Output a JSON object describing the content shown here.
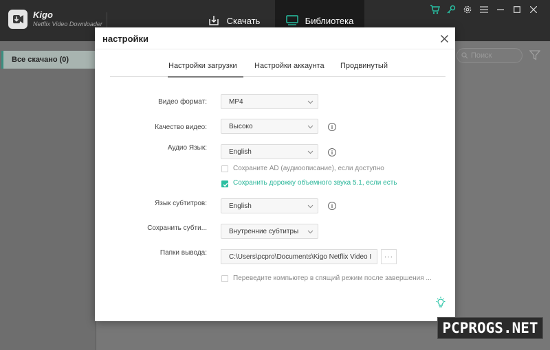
{
  "app": {
    "name": "Kigo",
    "subtitle": "Netflix Video Downloader",
    "accent_color": "#28c4a6"
  },
  "header": {
    "tabs": [
      {
        "label": "Скачать",
        "icon": "download-icon"
      },
      {
        "label": "Библиотека",
        "icon": "library-icon"
      }
    ],
    "icons": [
      "cart-icon",
      "key-icon",
      "gear-icon",
      "menu-icon",
      "minimize-icon",
      "maximize-icon",
      "close-icon"
    ]
  },
  "sidebar": {
    "items": [
      {
        "label": "Все скачано (0)"
      }
    ]
  },
  "toolbar": {
    "search_placeholder": "Поиск"
  },
  "dialog": {
    "title": "настройки",
    "tabs": [
      {
        "label": "Настройки загрузки",
        "active": true
      },
      {
        "label": "Настройки аккаунта",
        "active": false
      },
      {
        "label": "Продвинутый",
        "active": false
      }
    ],
    "fields": {
      "video_format": {
        "label": "Видео формат:",
        "value": "MP4"
      },
      "video_quality": {
        "label": "Качество видео:",
        "value": "Высоко"
      },
      "audio_language": {
        "label": "Аудио Язык:",
        "value": "English"
      },
      "subtitle_language": {
        "label": "Язык субтитров:",
        "value": "English"
      },
      "save_subtitles": {
        "label": "Сохранить субти...",
        "value": "Внутренние субтитры"
      },
      "output_folder": {
        "label": "Папки вывода:",
        "value": "C:\\Users\\pcpro\\Documents\\Kigo Netflix Video I",
        "browse_label": "···"
      }
    },
    "checkboxes": {
      "audio_description": {
        "label": "Сохраните AD (аудиоописание), если доступно",
        "checked": false
      },
      "surround_sound": {
        "label": "Сохранить дорожку объемного звука 5.1, если есть",
        "checked": true
      },
      "sleep_after": {
        "label": "Переведите компьютер в спящий режим после завершения ...",
        "checked": false
      }
    }
  },
  "watermark": {
    "text": "PCPROGS.NET"
  }
}
